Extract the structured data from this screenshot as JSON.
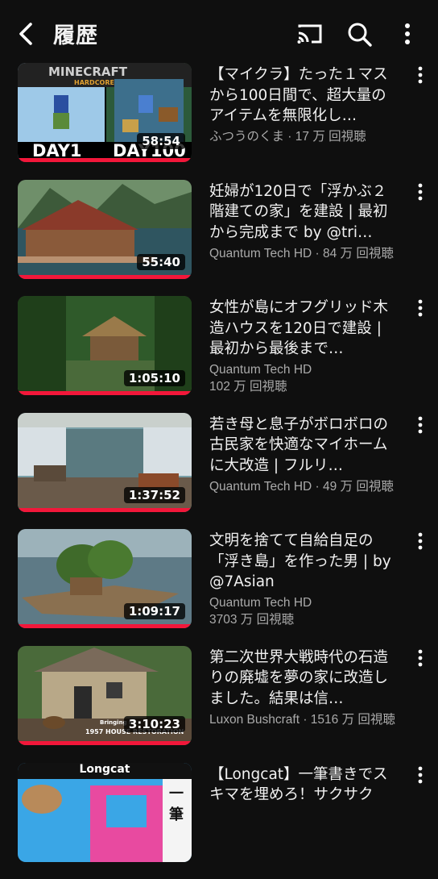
{
  "header": {
    "title": "履歴",
    "icons": [
      "back-arrow-icon",
      "cast-icon",
      "search-icon",
      "more-vert-icon"
    ]
  },
  "videos": [
    {
      "title": "【マイクラ】たった１マスから100日間で、超大量のアイテムを無限化し…",
      "meta_line1": "ふつうのくま · 17 万 回視聴",
      "meta_line2": "",
      "duration": "58:54",
      "thumb_text": {
        "logo": "MINECRAFT",
        "sub": "HARDCORE",
        "left": "DAY1",
        "right": "DAY100"
      }
    },
    {
      "title": "妊婦が120日で「浮かぶ２階建ての家」を建設 | 最初から完成まで by @tri…",
      "meta_line1": "Quantum Tech HD · 84 万 回視聴",
      "meta_line2": "",
      "duration": "55:40"
    },
    {
      "title": "女性が島にオフグリッド木造ハウスを120日で建設 | 最初から最後まで…",
      "meta_line1": "Quantum Tech HD",
      "meta_line2": "102 万 回視聴",
      "duration": "1:05:10"
    },
    {
      "title": "若き母と息子がボロボロの古民家を快適なマイホームに大改造 | フルリ…",
      "meta_line1": "Quantum Tech HD · 49 万 回視聴",
      "meta_line2": "",
      "duration": "1:37:52"
    },
    {
      "title": "文明を捨てて自給自足の「浮き島」を作った男 | by @7Asian",
      "meta_line1": "Quantum Tech HD",
      "meta_line2": "3703 万 回視聴",
      "duration": "1:09:17"
    },
    {
      "title": "第二次世界大戦時代の石造りの廃墟を夢の家に改造しました。結果は信…",
      "meta_line1": "Luxon Bushcraft · 1516 万 回視聴",
      "meta_line2": "",
      "duration": "3:10:23",
      "thumb_text": {
        "caption1": "Bringing it",
        "caption2": "1957 HOUSE RESTORATION"
      }
    },
    {
      "title": "【Longcat】一筆書きでスキマを埋めろ！サクサク",
      "meta_line1": "",
      "meta_line2": "",
      "duration": "",
      "thumb_text": {
        "label": "Longcat",
        "side": "一筆"
      }
    }
  ],
  "colors": {
    "background": "#0f0f0f",
    "progress": "#f2173a",
    "meta": "#aaaaaa"
  }
}
